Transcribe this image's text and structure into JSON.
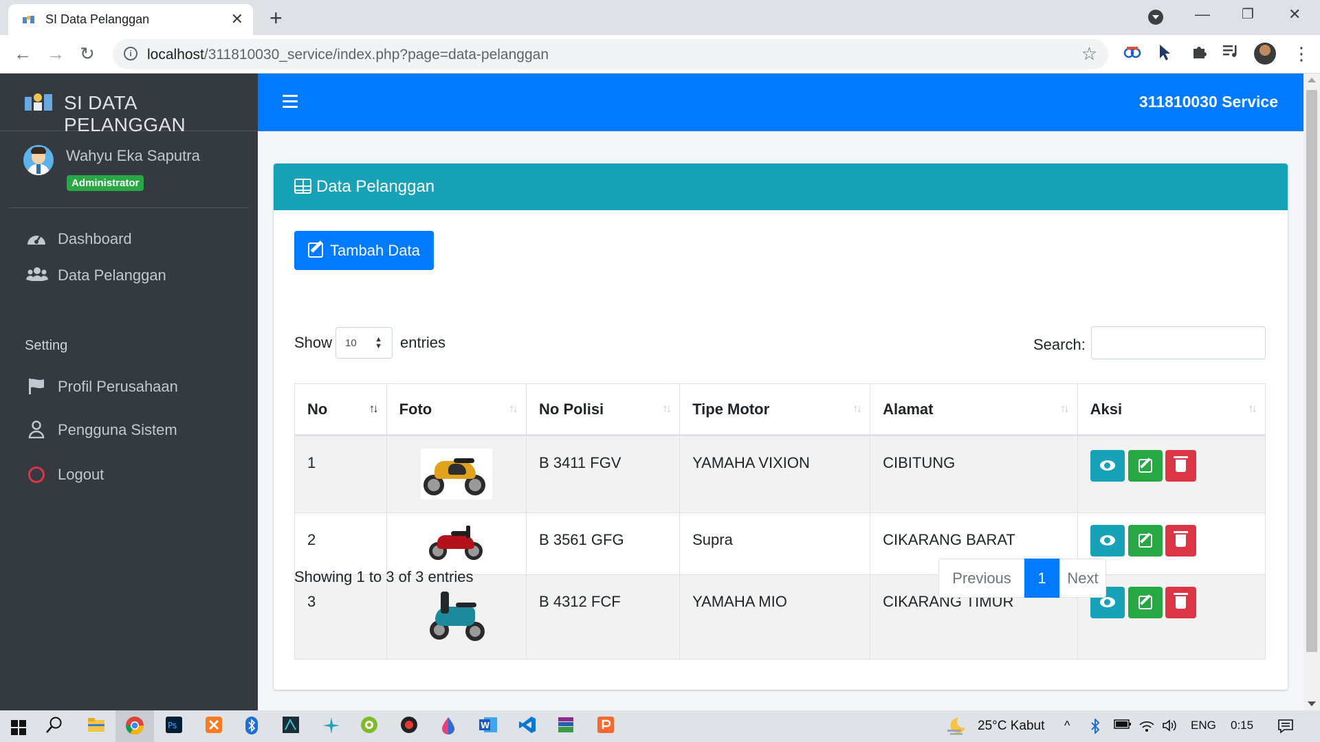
{
  "browser": {
    "tab_title": "SI Data Pelanggan",
    "url_host": "localhost",
    "url_path": "/311810030_service/index.php?page=data-pelanggan"
  },
  "sidebar": {
    "brand": "SI DATA PELANGGAN",
    "user_name": "Wahyu Eka Saputra",
    "user_role": "Administrator",
    "menu": [
      {
        "label": "Dashboard",
        "icon": "tachometer-icon"
      },
      {
        "label": "Data Pelanggan",
        "icon": "users-icon"
      }
    ],
    "setting_header": "Setting",
    "setting_menu": [
      {
        "label": "Profil Perusahaan",
        "icon": "flag-icon"
      },
      {
        "label": "Pengguna Sistem",
        "icon": "user-icon"
      },
      {
        "label": "Logout",
        "icon": "power-icon"
      }
    ]
  },
  "navbar": {
    "title": "311810030 Service"
  },
  "card": {
    "title": "Data Pelanggan",
    "add_button": "Tambah Data"
  },
  "datatable": {
    "show_label": "Show",
    "page_length": "10",
    "entries_label": "entries",
    "search_label": "Search:",
    "search_value": "",
    "columns": [
      "No",
      "Foto",
      "No Polisi",
      "Tipe Motor",
      "Alamat",
      "Aksi"
    ],
    "rows": [
      {
        "no": "1",
        "no_polisi": "B 3411 FGV",
        "tipe_motor": "YAMAHA VIXION",
        "alamat": "CIBITUNG"
      },
      {
        "no": "2",
        "no_polisi": "B 3561 GFG",
        "tipe_motor": "Supra",
        "alamat": "CIKARANG BARAT"
      },
      {
        "no": "3",
        "no_polisi": "B 4312 FCF",
        "tipe_motor": "YAMAHA MIO",
        "alamat": "CIKARANG TIMUR"
      }
    ],
    "info": "Showing 1 to 3 of 3 entries",
    "pagination": {
      "previous": "Previous",
      "current": "1",
      "next": "Next"
    }
  },
  "taskbar": {
    "weather": "25°C  Kabut",
    "language": "ENG",
    "time": "0:15"
  },
  "colors": {
    "primary": "#007bff",
    "info": "#17a2b8",
    "success": "#28a745",
    "danger": "#dc3545",
    "sidebar": "#343a40"
  }
}
